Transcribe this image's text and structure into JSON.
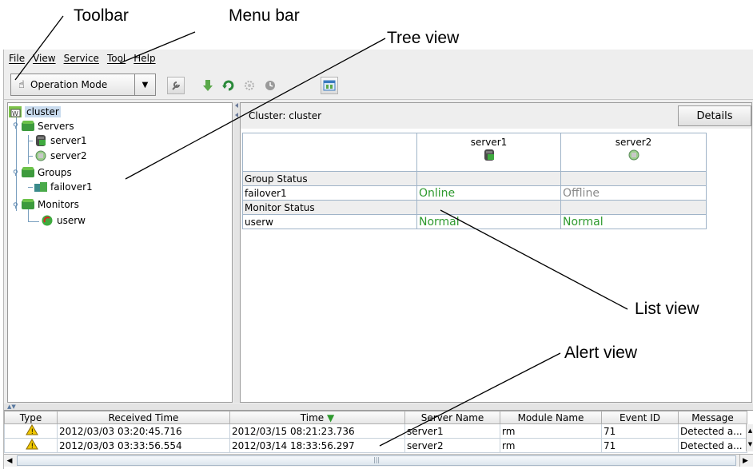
{
  "callouts": {
    "toolbar": "Toolbar",
    "menu_bar": "Menu bar",
    "tree_view": "Tree view",
    "list_view": "List view",
    "alert_view": "Alert view"
  },
  "menu": {
    "items": [
      {
        "label": "File"
      },
      {
        "label": "View"
      },
      {
        "label": "Service"
      },
      {
        "label": "Tool"
      },
      {
        "label": "Help"
      }
    ]
  },
  "toolbar": {
    "mode_label": "Operation Mode",
    "buttons": [
      "wrench-icon",
      "download-icon",
      "refresh-icon",
      "gear-icon",
      "clock-icon",
      "window-icon"
    ]
  },
  "tree": {
    "root": "cluster",
    "servers_label": "Servers",
    "server1": "server1",
    "server2": "server2",
    "groups_label": "Groups",
    "failover1": "failover1",
    "monitors_label": "Monitors",
    "userw": "userw"
  },
  "list": {
    "title": "Cluster: cluster",
    "details_label": "Details",
    "col1": "server1",
    "col2": "server2",
    "group_status_label": "Group Status",
    "group_row": {
      "name": "failover1",
      "server1": "Online",
      "server2": "Offline"
    },
    "monitor_status_label": "Monitor Status",
    "monitor_row": {
      "name": "userw",
      "server1": "Normal",
      "server2": "Normal"
    }
  },
  "alerts": {
    "columns": {
      "type": "Type",
      "received": "Received Time",
      "time": "Time",
      "server": "Server Name",
      "module": "Module Name",
      "event": "Event ID",
      "message": "Message"
    },
    "rows": [
      {
        "received": "2012/03/03 03:20:45.716",
        "time": "2012/03/15 08:21:23.736",
        "server": "server1",
        "module": "rm",
        "event": "71",
        "message": "Detected a..."
      },
      {
        "received": "2012/03/03 03:33:56.554",
        "time": "2012/03/14 18:33:56.297",
        "server": "server2",
        "module": "rm",
        "event": "71",
        "message": "Detected a..."
      }
    ]
  },
  "colors": {
    "online": "#2e9a2e",
    "offline": "#8a8a8a",
    "warning": "#f0c800",
    "selection": "#c9dbee"
  }
}
